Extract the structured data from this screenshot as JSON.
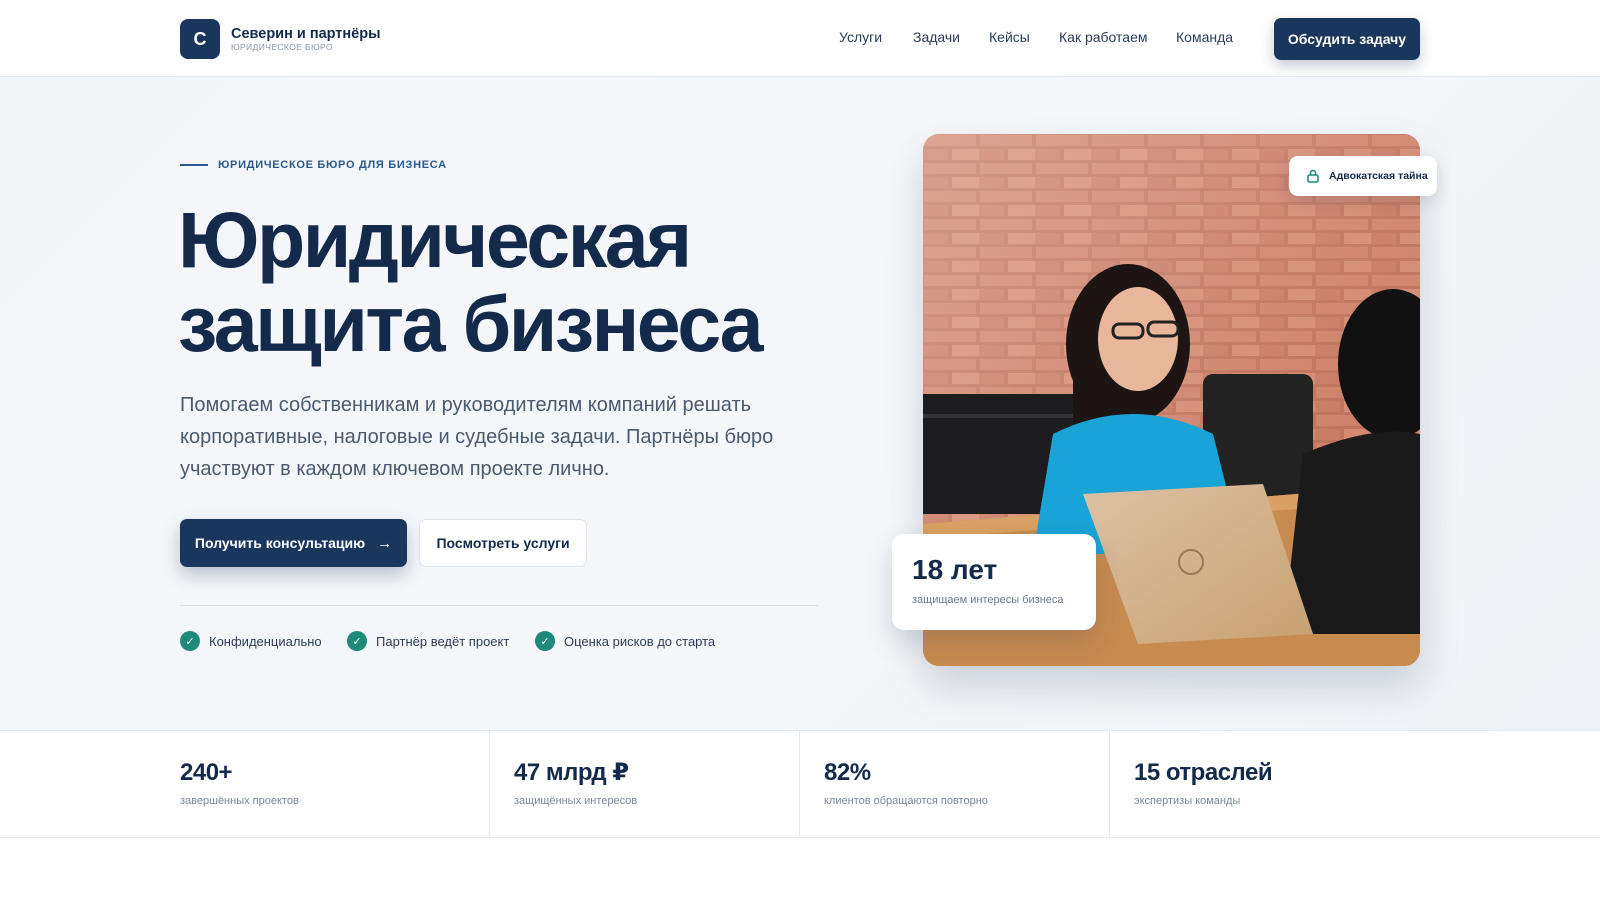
{
  "header": {
    "logo_letter": "С",
    "brand_name": "Северин и партнёры",
    "brand_sub": "ЮРИДИЧЕСКОЕ БЮРО",
    "nav": [
      "Услуги",
      "Задачи",
      "Кейсы",
      "Как работаем",
      "Команда"
    ],
    "cta_label": "Обсудить задачу"
  },
  "hero": {
    "eyebrow": "ЮРИДИЧЕСКОЕ БЮРО ДЛЯ БИЗНЕСА",
    "title_line1": "Юридическая",
    "title_line2": "защита бизнеса",
    "lead": "Помогаем собственникам и руководителям компаний решать корпоративные, налоговые и судебные задачи. Партнёры бюро участвуют в каждом ключевом проекте лично.",
    "primary_button": "Получить консультацию",
    "secondary_button": "Посмотреть услуги",
    "features": [
      "Конфиденциально",
      "Партнёр ведёт проект",
      "Оценка рисков до старта"
    ],
    "badge_label": "Адвокатская тайна",
    "years_value": "18 лет",
    "years_caption": "защищаем интересы бизнеса"
  },
  "stats": [
    {
      "value": "240+",
      "caption": "завершённых проектов"
    },
    {
      "value": "47 млрд ₽",
      "caption": "защищённых интересов"
    },
    {
      "value": "82%",
      "caption": "клиентов обращаются повторно"
    },
    {
      "value": "15 отраслей",
      "caption": "экспертизы команды"
    }
  ],
  "colors": {
    "primary": "#1b365d",
    "accent": "#2a5a8c",
    "success": "#1f8a7a",
    "text": "#142a4a"
  },
  "icons": {
    "arrow": "arrow-right-icon",
    "check": "check-icon",
    "lock": "lock-icon"
  }
}
